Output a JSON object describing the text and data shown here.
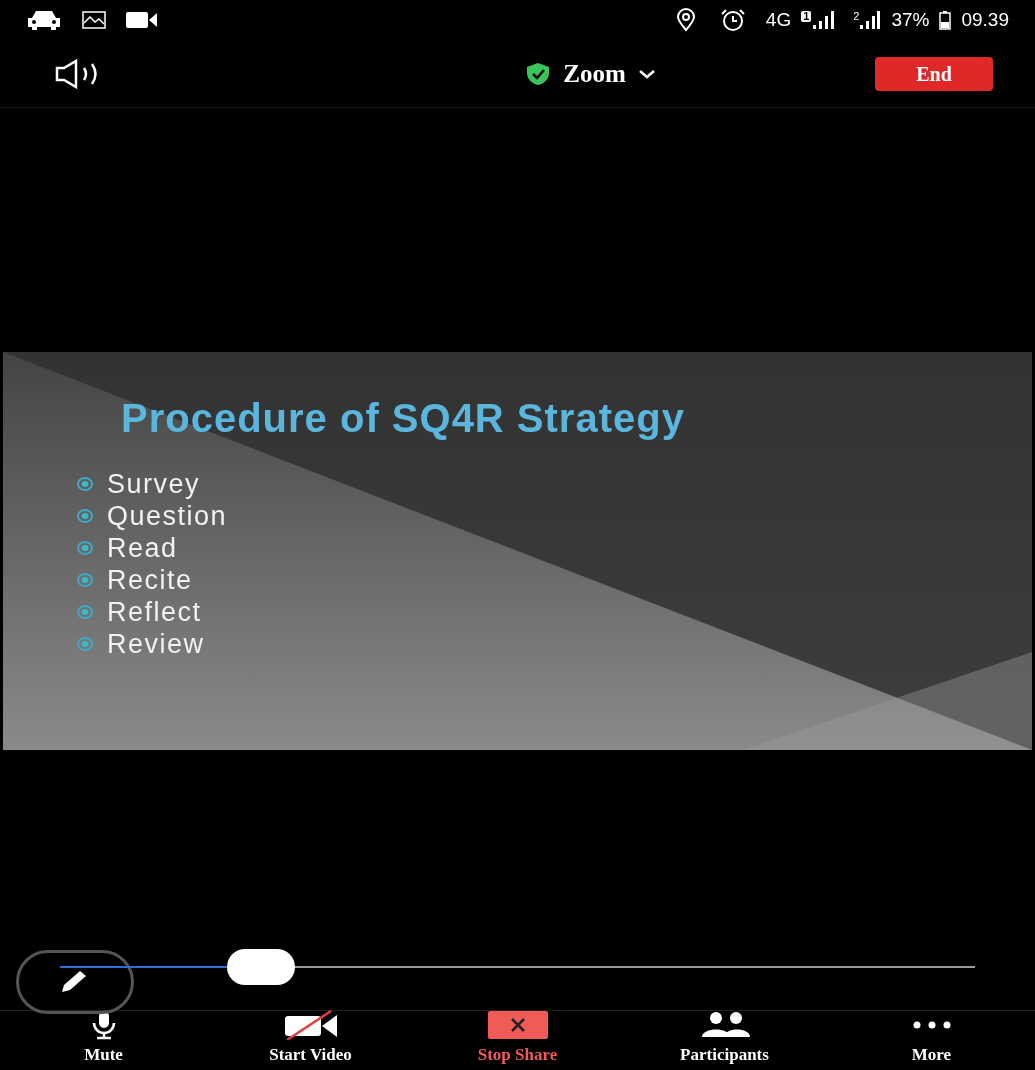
{
  "status_bar": {
    "network": "4G",
    "sim_1": "1",
    "sim_2": "2",
    "battery": "37%",
    "time": "09.39"
  },
  "meeting_bar": {
    "title": "Zoom",
    "end_button": "End"
  },
  "slide": {
    "title": "Procedure of SQ4R Strategy",
    "bullets": [
      "Survey",
      "Question",
      "Read",
      "Recite",
      "Reflect",
      "Review"
    ]
  },
  "annotation_slider": {
    "level": 0.22
  },
  "toolbar": [
    {
      "kind": "mic",
      "label": "Mute",
      "active": false
    },
    {
      "kind": "video-off",
      "label": "Start Video",
      "active": false
    },
    {
      "kind": "share",
      "label": "Stop Share",
      "active": true
    },
    {
      "kind": "people",
      "label": "Participants",
      "active": false
    },
    {
      "kind": "more",
      "label": "More",
      "active": false
    }
  ]
}
